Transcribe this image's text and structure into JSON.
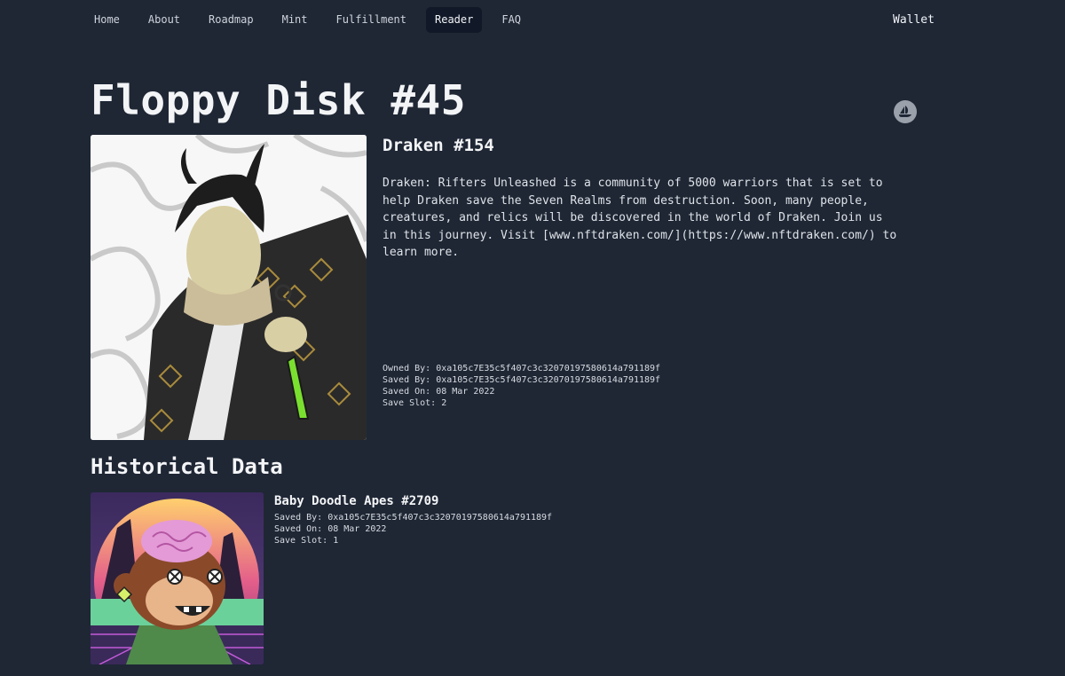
{
  "nav": {
    "items": [
      {
        "label": "Home",
        "active": false
      },
      {
        "label": "About",
        "active": false
      },
      {
        "label": "Roadmap",
        "active": false
      },
      {
        "label": "Mint",
        "active": false
      },
      {
        "label": "Fulfillment",
        "active": false
      },
      {
        "label": "Reader",
        "active": true
      },
      {
        "label": "FAQ",
        "active": false
      }
    ],
    "wallet_label": "Wallet"
  },
  "page": {
    "title": "Floppy Disk #45",
    "opensea_icon": "opensea-icon"
  },
  "current": {
    "name": "Draken #154",
    "description": "Draken: Rifters Unleashed is a community of 5000 warriors that is set to help Draken save the Seven Realms from destruction. Soon, many people, creatures, and relics will be discovered in the world of Draken. Join us in this journey. Visit [www.nftdraken.com/](https://www.nftdraken.com/) to learn more.",
    "owned_by": "Owned By: 0xa105c7E35c5f407c3c32070197580614a791189f",
    "saved_by": "Saved By: 0xa105c7E35c5f407c3c32070197580614a791189f",
    "saved_on": "Saved On: 08 Mar 2022",
    "save_slot": "Save Slot: 2"
  },
  "history": {
    "title": "Historical Data",
    "items": [
      {
        "name": "Baby Doodle Apes #2709",
        "saved_by": "Saved By: 0xa105c7E35c5f407c3c32070197580614a791189f",
        "saved_on": "Saved On: 08 Mar 2022",
        "save_slot": "Save Slot: 1"
      }
    ]
  },
  "colors": {
    "background": "#1f2735",
    "active_nav": "#111827",
    "text": "#e6e8ec"
  }
}
